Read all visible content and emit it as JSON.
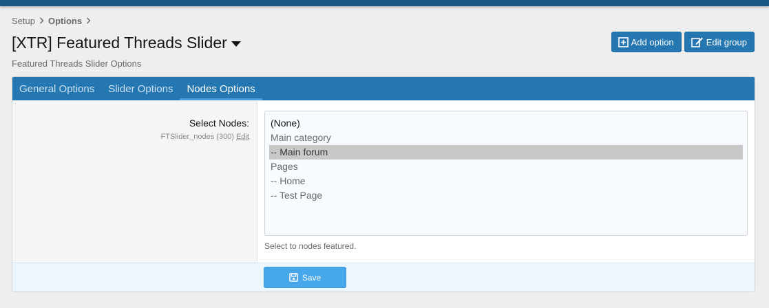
{
  "breadcrumb": {
    "items": [
      "Setup",
      "Options"
    ],
    "separator_icon": "chevron-right-icon"
  },
  "page": {
    "title": "[XTR] Featured Threads Slider",
    "description": "Featured Threads Slider Options"
  },
  "actions": {
    "add_option_label": "Add option",
    "edit_group_label": "Edit group"
  },
  "tabs": [
    {
      "label": "General Options",
      "active": false
    },
    {
      "label": "Slider Options",
      "active": false
    },
    {
      "label": "Nodes Options",
      "active": true
    }
  ],
  "field": {
    "label": "Select Nodes:",
    "hint": "FTSlider_nodes (300)",
    "edit_label": "Edit",
    "options": [
      {
        "label": "(None)",
        "selected": false
      },
      {
        "label": "Main category",
        "selected": false
      },
      {
        "label": "-- Main forum",
        "selected": true
      },
      {
        "label": "Pages",
        "selected": false
      },
      {
        "label": "-- Home",
        "selected": false
      },
      {
        "label": "-- Test Page",
        "selected": false
      }
    ],
    "explain": "Select to nodes featured."
  },
  "submit": {
    "save_label": "Save"
  },
  "colors": {
    "accent": "#2577b1",
    "header_bar": "#185886",
    "save_button": "#47a7eb",
    "selected_option": "#c8c8c8"
  }
}
